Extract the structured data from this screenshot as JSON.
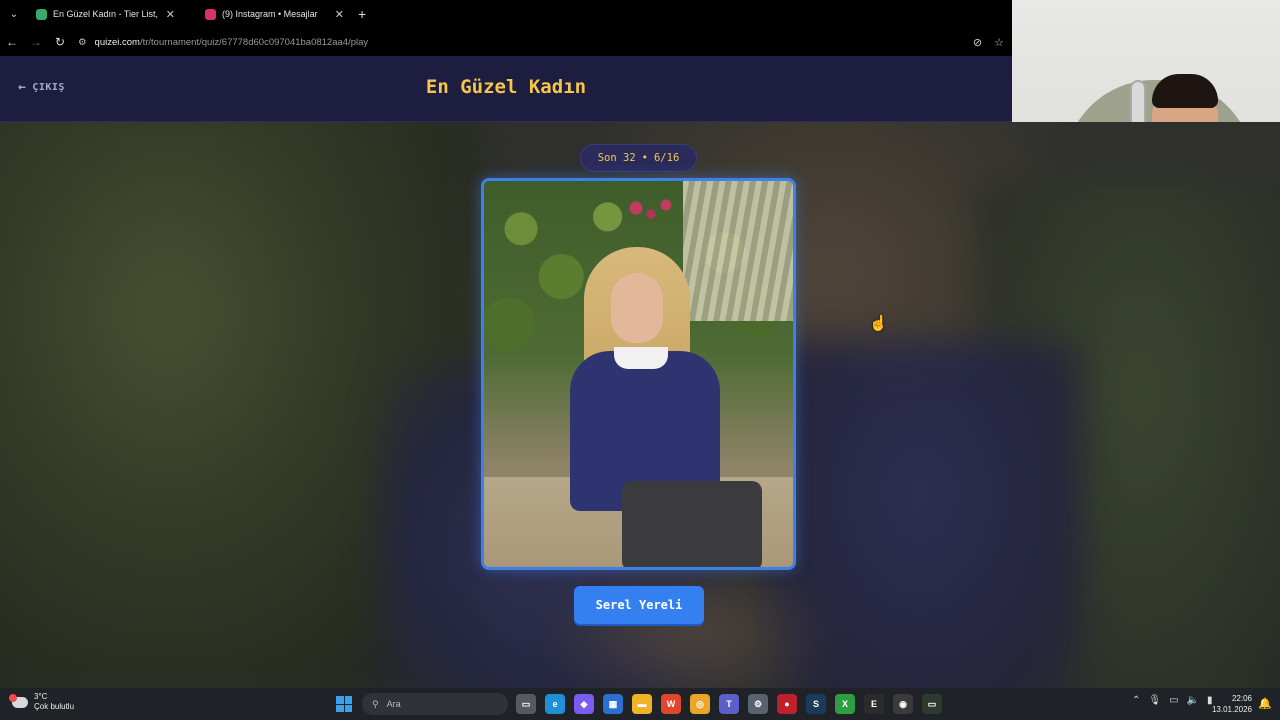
{
  "browser": {
    "tabs": [
      {
        "title": "En Güzel Kadın - Tier List, Kör S",
        "favicon_color": "#3aa76d",
        "active": true
      },
      {
        "title": "(9) Instagram • Mesajlar",
        "favicon_color": "#d6336c",
        "active": false
      }
    ],
    "url_host": "quizei.com",
    "url_path": "/tr/tournament/quiz/67778d60c097041ba0812aa4/play"
  },
  "app": {
    "exit_label": "ÇIKIŞ",
    "title": "En Güzel Kadın",
    "round_label": "Son 32",
    "round_sep": "•",
    "round_progress": "6/16",
    "candidate_name": "Serel Yereli"
  },
  "taskbar": {
    "weather_temp": "3°C",
    "weather_desc": "Çok bulutlu",
    "search_placeholder": "Ara",
    "time": "22:06",
    "date": "13.01.2026",
    "apps": [
      {
        "name": "task-view-icon",
        "color": "#555a62",
        "glyph": "▭"
      },
      {
        "name": "edge-icon",
        "color": "#1f8fd6",
        "glyph": "e"
      },
      {
        "name": "copilot-icon",
        "color": "#7b5cf0",
        "glyph": "◆"
      },
      {
        "name": "store-icon",
        "color": "#2a6fd1",
        "glyph": "▦"
      },
      {
        "name": "explorer-icon",
        "color": "#f0b429",
        "glyph": "▬"
      },
      {
        "name": "office-icon",
        "color": "#e0452e",
        "glyph": "W"
      },
      {
        "name": "chrome-icon",
        "color": "#e9a628",
        "glyph": "◎"
      },
      {
        "name": "teams-icon",
        "color": "#5b5fc7",
        "glyph": "T"
      },
      {
        "name": "settings-icon",
        "color": "#5a6270",
        "glyph": "⚙"
      },
      {
        "name": "app-red-icon",
        "color": "#c0202a",
        "glyph": "●"
      },
      {
        "name": "steam-icon",
        "color": "#1b3a5c",
        "glyph": "S"
      },
      {
        "name": "xbox-icon",
        "color": "#2f9e41",
        "glyph": "X"
      },
      {
        "name": "epic-icon",
        "color": "#2b2b2b",
        "glyph": "E"
      },
      {
        "name": "obs-icon",
        "color": "#3a3a3a",
        "glyph": "◉"
      },
      {
        "name": "battery-app-icon",
        "color": "#2e3a2e",
        "glyph": "▭"
      }
    ]
  }
}
